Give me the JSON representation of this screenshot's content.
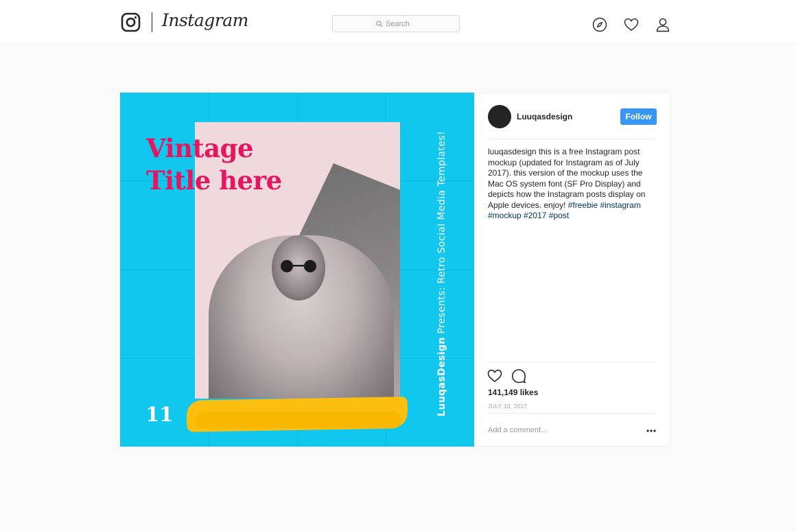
{
  "app": {
    "wordmark": "Instagram",
    "search": {
      "placeholder": "Search"
    },
    "nav_icons": [
      "explore-compass-icon",
      "activity-heart-icon",
      "profile-person-icon"
    ]
  },
  "post": {
    "image": {
      "title": "Vintage\nTitle here",
      "number": "11",
      "vertical_brand": "LuuqasDesign",
      "vertical_rest": " Presents: Retro Social Media Templates!",
      "background_color": "#11c7ee",
      "title_color": "#e5155f",
      "brush_color": "#fdbf0f"
    },
    "author": {
      "username": "Luuqasdesign",
      "follow_label": "Follow"
    },
    "caption": {
      "username": "luuqasdesign",
      "text": " this is a free Instagram post mockup (updated for Instagram as of July 2017). this version of the mockup uses the Mac OS system font (SF Pro Display) and depicts how the Instagram posts display on Apple devices. enjoy! ",
      "hashtags": [
        "#freebie",
        "#instagram",
        "#mockup",
        "#2017",
        "#post"
      ]
    },
    "likes": "141,149 likes",
    "date": "JULY 10, 2017",
    "comment_placeholder": "Add a comment...",
    "accent_color": "#3897f0"
  }
}
